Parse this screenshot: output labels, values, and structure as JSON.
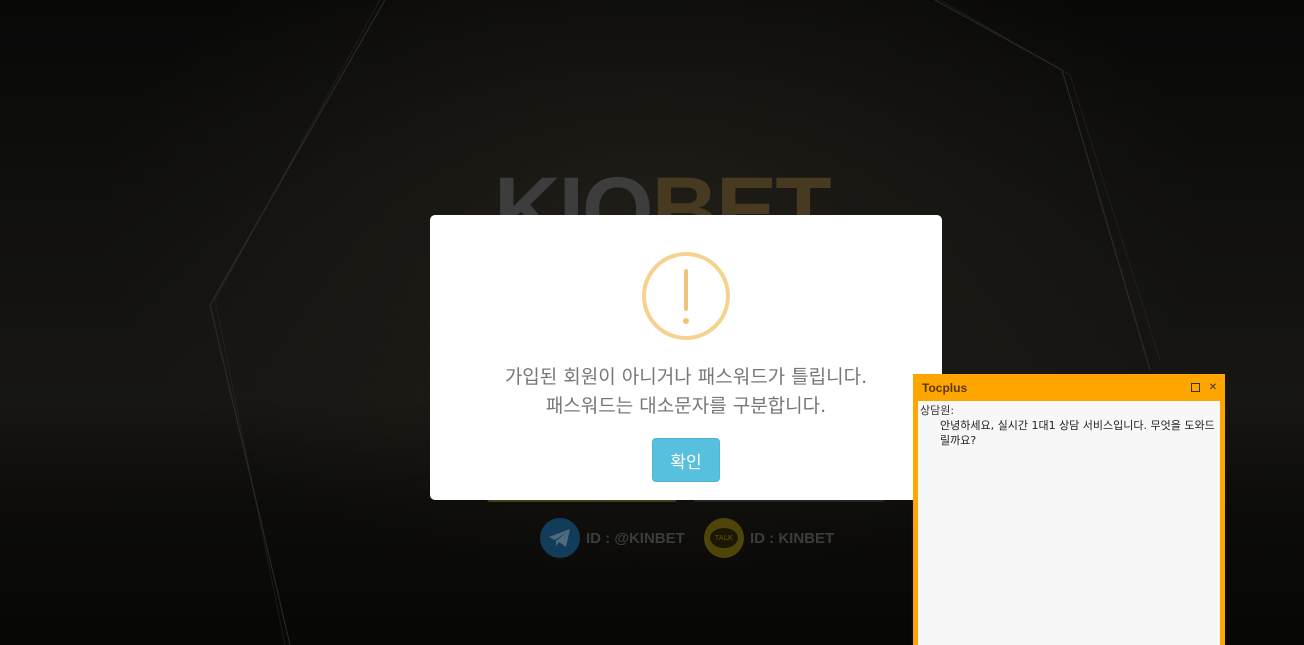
{
  "brand": {
    "logo_part1": "KIO",
    "logo_part2": "BET"
  },
  "social": {
    "telegram_id": "ID : @KINBET",
    "kakao_id": "ID : KINBET",
    "kakao_badge": "TALK"
  },
  "modal": {
    "line1": "가입된 회원이 아니거나 패스워드가 틀립니다.",
    "line2": "패스워드는 대소문자를 구분합니다.",
    "confirm_label": "확인",
    "icon": "warning-icon"
  },
  "chat": {
    "title": "Tocplus",
    "agent_label": "상담원:",
    "message": "안녕하세요, 실시간 1대1 상담 서비스입니다. 무엇을 도와드릴까요?"
  },
  "colors": {
    "modal_button": "#58c0df",
    "warning": "#f5d28d",
    "chat_frame": "#ffa500"
  }
}
